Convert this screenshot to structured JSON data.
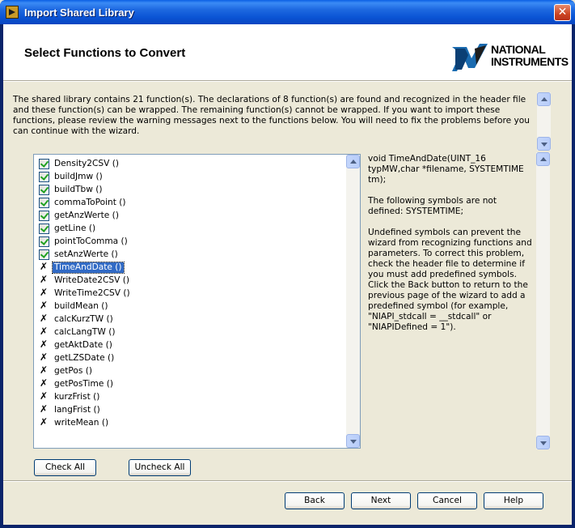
{
  "window": {
    "title": "Import Shared Library",
    "close_symbol": "✕"
  },
  "header": {
    "page_title": "Select Functions to Convert",
    "logo_line1": "NATIONAL",
    "logo_line2": "INSTRUMENTS",
    "logo_icon": "ni-eagle-logo"
  },
  "description": "The shared library contains 21 function(s). The declarations of 8 function(s) are found and recognized in the header file and these function(s) can be wrapped. The remaining function(s) cannot be wrapped. If you want to import these functions, please review the warning messages next to the functions below. You will need to fix the problems before you can continue with the wizard.",
  "functions": [
    {
      "label": "Density2CSV ()",
      "status": "checked"
    },
    {
      "label": "buildJmw ()",
      "status": "checked"
    },
    {
      "label": "buildTbw ()",
      "status": "checked"
    },
    {
      "label": "commaToPoint ()",
      "status": "checked"
    },
    {
      "label": "getAnzWerte ()",
      "status": "checked"
    },
    {
      "label": "getLine ()",
      "status": "checked"
    },
    {
      "label": "pointToComma ()",
      "status": "checked"
    },
    {
      "label": "setAnzWerte ()",
      "status": "checked"
    },
    {
      "label": "TimeAndDate ()",
      "status": "error",
      "selected": true
    },
    {
      "label": "WriteDate2CSV ()",
      "status": "error"
    },
    {
      "label": "WriteTime2CSV ()",
      "status": "error"
    },
    {
      "label": "buildMean ()",
      "status": "error"
    },
    {
      "label": "calcKurzTW ()",
      "status": "error"
    },
    {
      "label": "calcLangTW ()",
      "status": "error"
    },
    {
      "label": "getAktDate ()",
      "status": "error"
    },
    {
      "label": "getLZSDate ()",
      "status": "error"
    },
    {
      "label": "getPos ()",
      "status": "error"
    },
    {
      "label": "getPosTime ()",
      "status": "error"
    },
    {
      "label": "kurzFrist ()",
      "status": "error"
    },
    {
      "label": "langFrist ()",
      "status": "error"
    },
    {
      "label": "writeMean ()",
      "status": "error"
    }
  ],
  "error_mark": "✗",
  "detail": {
    "declaration": "void TimeAndDate(UINT_16 typMW,char *filename, SYSTEMTIME tm);",
    "undefined_heading": "The following symbols are not defined: SYSTEMTIME;",
    "explanation": "Undefined symbols can prevent the wizard from recognizing functions and parameters. To correct this problem, check the header file to determine if you must add predefined symbols. Click the Back button to return to the previous page of the wizard to add a predefined symbol (for example, \"NIAPI_stdcall = __stdcall\" or \"NIAPIDefined = 1\")."
  },
  "buttons": {
    "check_all": "Check All",
    "uncheck_all": "Uncheck All",
    "back": "Back",
    "next": "Next",
    "cancel": "Cancel",
    "help": "Help"
  },
  "colors": {
    "title_bar": "#0b55d5",
    "selection": "#316ac5",
    "check_green": "#21a121"
  }
}
